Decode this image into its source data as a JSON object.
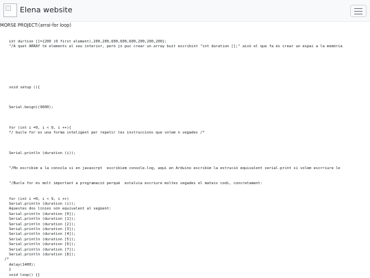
{
  "navbar": {
    "brand_name": "Elena website",
    "logo_icon": "broken-image-icon",
    "toggler_icon": "hamburger-menu-icon"
  },
  "page": {
    "title": "MORSE PROJECT:(arrai-for loop)"
  },
  "code_lines": [
    "    int durtion []={200 (0 first element),200,200,600,600,600,200,200,200};",
    "    \"/A quet ARRAY tè elements al seu interior, però jo puc crear un array buit escribint \"int duration [];\" això el que fa és crear un espai a la memòria",
    "",
    "",
    "",
    "",
    "",
    "",
    "",
    "    void setup (){",
    "",
    "",
    "",
    "    Serial.beign((9600);",
    "",
    "",
    "",
    "    for (int i =0, i < 9, i ++){",
    "    */ bucle for es una forma inteligent per repetir les instruccions que volem n vegades /*",
    "",
    "",
    "",
    "    Serial.println (duration (i));",
    "",
    "",
    "    \"/Mo escribim a la consola si en javascrpt  escribiem console.log, aquí en Arduino escribim la estrució equivalent serial.print si volem escrriure le",
    "",
    "",
    "    \"/Bucle for és molt important a programació perquè  estalvia escriure moltes vegades el mateix codi, concretament:",
    "",
    "",
    "    for (int i =0, i < 9, i ++)",
    "    Serial.println (duration (i));",
    "    Aquestes dos linies són equivalent al següent:",
    "    Serial.println (duration [0]);",
    "    Serial.println (duration [1]);",
    "    Serial.println (duration [2]);",
    "    Serial.println (duration [3]);",
    "    Serial.println (duration [4]);",
    "    Serial.println (duration [5]);",
    "    Serial.println (duration [6]);",
    "    Serial.println (duration [7]);",
    "    Serial.println (duration [8]);",
    "  /*",
    "    delay(1400);",
    "    }",
    "    void loop() {}"
  ]
}
